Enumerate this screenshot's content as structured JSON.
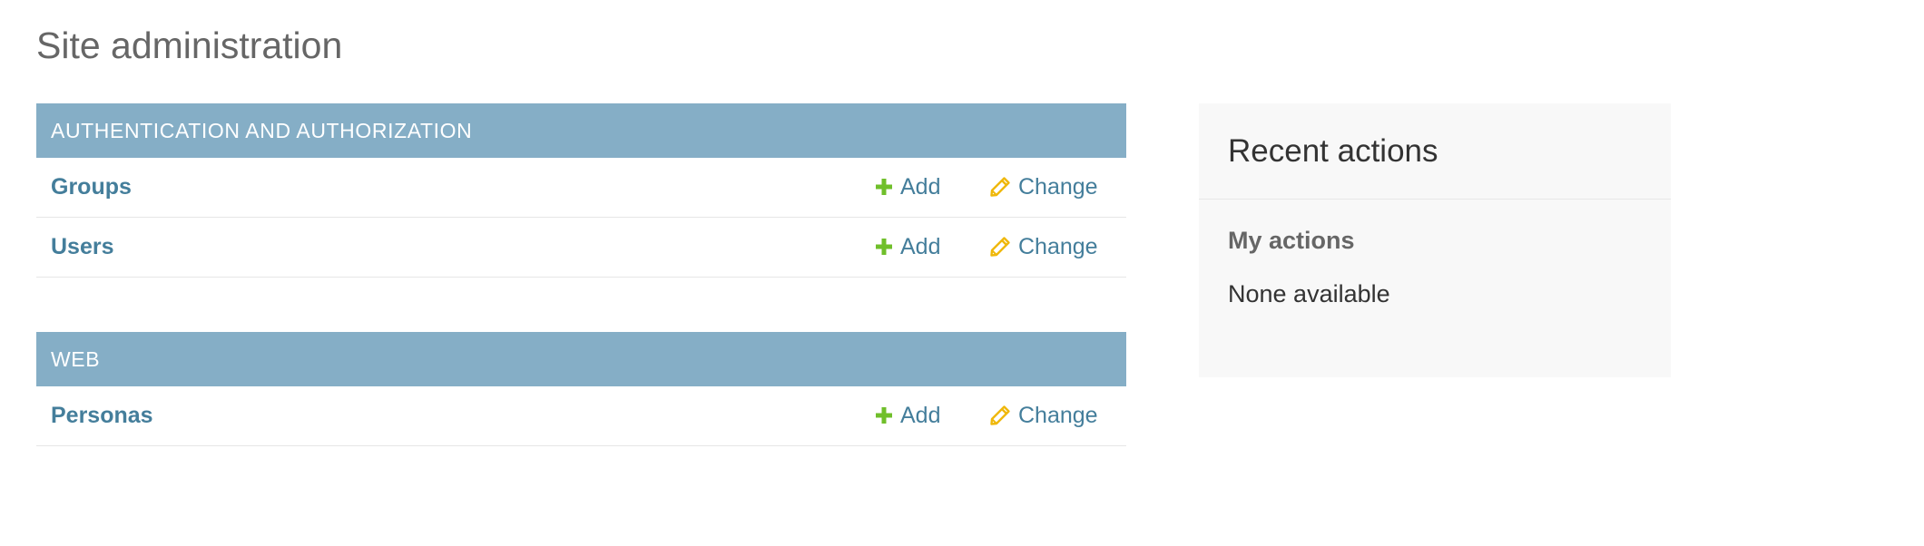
{
  "page": {
    "title": "Site administration"
  },
  "apps": [
    {
      "caption": "Authentication and Authorization",
      "models": [
        {
          "name": "Groups",
          "add_label": "Add",
          "change_label": "Change"
        },
        {
          "name": "Users",
          "add_label": "Add",
          "change_label": "Change"
        }
      ]
    },
    {
      "caption": "Web",
      "models": [
        {
          "name": "Personas",
          "add_label": "Add",
          "change_label": "Change"
        }
      ]
    }
  ],
  "recent_actions": {
    "title": "Recent actions",
    "subtitle": "My actions",
    "empty_text": "None available"
  },
  "icons": {
    "add": "plus-icon",
    "change": "pencil-icon"
  },
  "colors": {
    "caption_bg": "#85aec6",
    "link": "#447e9b",
    "add_icon": "#70bf2b",
    "change_icon": "#efb80b"
  }
}
